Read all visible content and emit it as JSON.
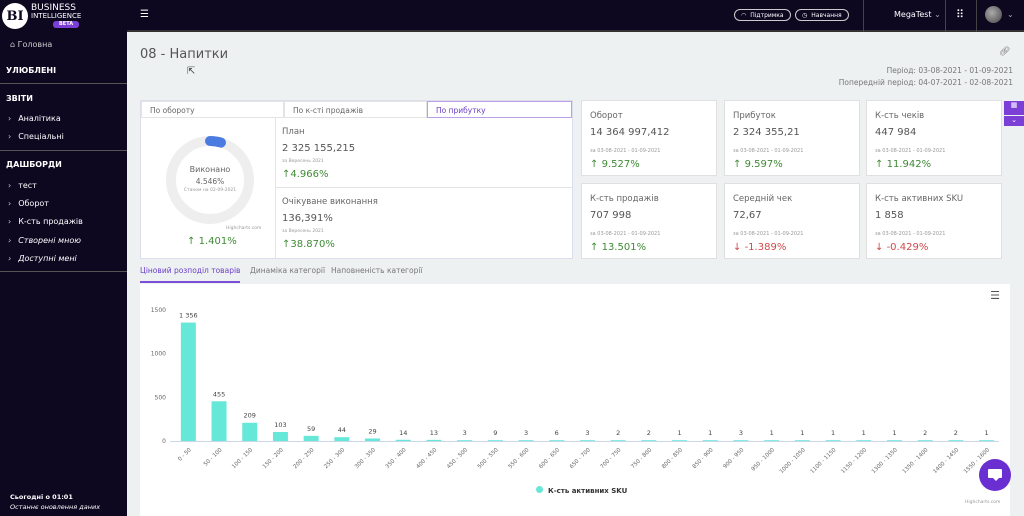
{
  "brand": {
    "logo": "BI",
    "line1": "BUSINESS",
    "line2": "INTELLIGENCE",
    "beta": "BETA"
  },
  "sidebar": {
    "home": "Головна",
    "favorites": "УЛЮБЛЕНІ",
    "reports": "ЗВІТИ",
    "report_items": [
      "Аналітика",
      "Спеціальні"
    ],
    "dashboards": "ДАШБОРДИ",
    "dashboard_items": [
      "тест",
      "Оборот",
      "К-сть продажів",
      "Створені мною",
      "Доступні мені"
    ],
    "footer_time": "Сьогодні о 01:01",
    "footer_note": "Останнє оновлення даних"
  },
  "topbar": {
    "support": "Підтримка",
    "training": "Навчання",
    "account": "MegaTest"
  },
  "page": {
    "title": "08 - Напитки",
    "period": "Період: 03-08-2021 - 01-09-2021",
    "prev_period": "Попередній період: 04-07-2021 - 02-08-2021"
  },
  "plan_tabs": [
    "По обороту",
    "По к-сті продажів",
    "По прибутку"
  ],
  "gauge": {
    "label": "Виконано",
    "value": "4.546%",
    "as_of": "Станом на 02-09-2021",
    "credit": "Highcharts.com",
    "change": "1.401%",
    "fraction": 0.04546
  },
  "plan": {
    "label": "План",
    "value": "2 325 155,215",
    "period": "за Вересень 2021",
    "change": "4.966%"
  },
  "expected": {
    "label": "Очікуване виконання",
    "value": "136,391%",
    "period": "за Вересень 2021",
    "change": "38.870%"
  },
  "cards": [
    {
      "label": "Оборот",
      "value": "14 364 997,412",
      "period": "за 03-08-2021 - 01-09-2021",
      "change": "9.527%",
      "dir": "up"
    },
    {
      "label": "Прибуток",
      "value": "2 324 355,21",
      "period": "за 03-08-2021 - 01-09-2021",
      "change": "9.597%",
      "dir": "up"
    },
    {
      "label": "К-сть чеків",
      "value": "447 984",
      "period": "за 03-08-2021 - 01-09-2021",
      "change": "11.942%",
      "dir": "up"
    },
    {
      "label": "К-сть продажів",
      "value": "707 998",
      "period": "за 03-08-2021 - 01-09-2021",
      "change": "13.501%",
      "dir": "up"
    },
    {
      "label": "Середній чек",
      "value": "72,67",
      "period": "за 03-08-2021 - 01-09-2021",
      "change": "-1.389%",
      "dir": "down"
    },
    {
      "label": "К-сть активних SKU",
      "value": "1 858",
      "period": "за 03-08-2021 - 01-09-2021",
      "change": "-0.429%",
      "dir": "down"
    }
  ],
  "chart_tabs": [
    "Ціновий розподіл товарів",
    "Динаміка категорії",
    "Наповненість категорії"
  ],
  "chart_data": {
    "type": "bar",
    "categories": [
      "0 - 50",
      "50 - 100",
      "100 - 150",
      "150 - 200",
      "200 - 250",
      "250 - 300",
      "300 - 350",
      "350 - 400",
      "400 - 450",
      "450 - 500",
      "500 - 550",
      "550 - 600",
      "600 - 650",
      "650 - 700",
      "700 - 750",
      "750 - 800",
      "800 - 850",
      "850 - 900",
      "900 - 950",
      "950 - 1000",
      "1000 - 1050",
      "1100 - 1150",
      "1150 - 1200",
      "1300 - 1350",
      "1350 - 1400",
      "1400 - 1450",
      "1550 - 1600"
    ],
    "series": [
      {
        "name": "К-сть активних SKU",
        "values": [
          1356,
          455,
          209,
          103,
          59,
          44,
          29,
          14,
          13,
          3,
          9,
          3,
          6,
          3,
          2,
          2,
          1,
          1,
          3,
          1,
          1,
          1,
          1,
          1,
          2,
          2,
          1
        ],
        "labels": [
          "1 356",
          "455",
          "209",
          "103",
          "59",
          "44",
          "29",
          "14",
          "13",
          "3",
          "9",
          "3",
          "6",
          "3",
          "2",
          "2",
          "1",
          "1",
          "3",
          "1",
          "1",
          "1",
          "1",
          "1",
          "2",
          "2",
          "1"
        ]
      }
    ],
    "yticks": [
      0,
      500,
      1000,
      1500
    ],
    "ylim": [
      0,
      1500
    ],
    "color": "#66e8d8",
    "legend": "bottom",
    "credit": "Highcharts.com"
  },
  "colors": {
    "accent": "#7b3fd8",
    "sidebar": "#0d0720",
    "up": "#3f8a35",
    "down": "#d04848"
  }
}
